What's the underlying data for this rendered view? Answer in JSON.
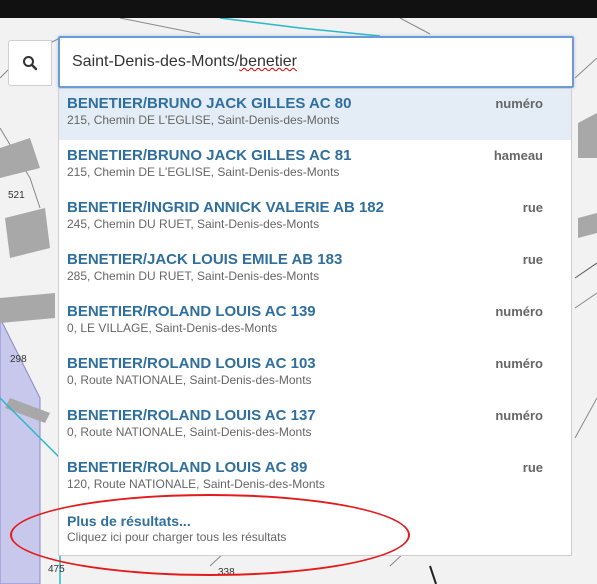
{
  "search": {
    "query_prefix": "Saint-Denis-des-Monts/",
    "query_misspelled": "benetier"
  },
  "map": {
    "parcel_labels": [
      "521",
      "298",
      "338",
      "475"
    ]
  },
  "results": [
    {
      "title": "BENETIER/BRUNO JACK GILLES AC 80",
      "address": "215, Chemin DE L'EGLISE, Saint-Denis-des-Monts",
      "type": "numéro"
    },
    {
      "title": "BENETIER/BRUNO JACK GILLES AC 81",
      "address": "215, Chemin DE L'EGLISE, Saint-Denis-des-Monts",
      "type": "hameau"
    },
    {
      "title": "BENETIER/INGRID ANNICK VALERIE AB 182",
      "address": "245, Chemin DU RUET, Saint-Denis-des-Monts",
      "type": "rue"
    },
    {
      "title": "BENETIER/JACK LOUIS EMILE AB 183",
      "address": "285, Chemin DU RUET, Saint-Denis-des-Monts",
      "type": "rue"
    },
    {
      "title": "BENETIER/ROLAND LOUIS AC 139",
      "address": "0, LE VILLAGE, Saint-Denis-des-Monts",
      "type": "numéro"
    },
    {
      "title": "BENETIER/ROLAND LOUIS AC 103",
      "address": "0, Route NATIONALE, Saint-Denis-des-Monts",
      "type": "numéro"
    },
    {
      "title": "BENETIER/ROLAND LOUIS AC 137",
      "address": "0, Route NATIONALE, Saint-Denis-des-Monts",
      "type": "numéro"
    },
    {
      "title": "BENETIER/ROLAND LOUIS AC 89",
      "address": "120, Route NATIONALE, Saint-Denis-des-Monts",
      "type": "rue"
    }
  ],
  "more_results": {
    "title": "Plus de résultats...",
    "subtitle": "Cliquez ici pour charger tous les résultats"
  },
  "colors": {
    "accent": "#2f6f9d",
    "highlight": "#e31b1b",
    "selected_bg": "#e4ecf5"
  }
}
